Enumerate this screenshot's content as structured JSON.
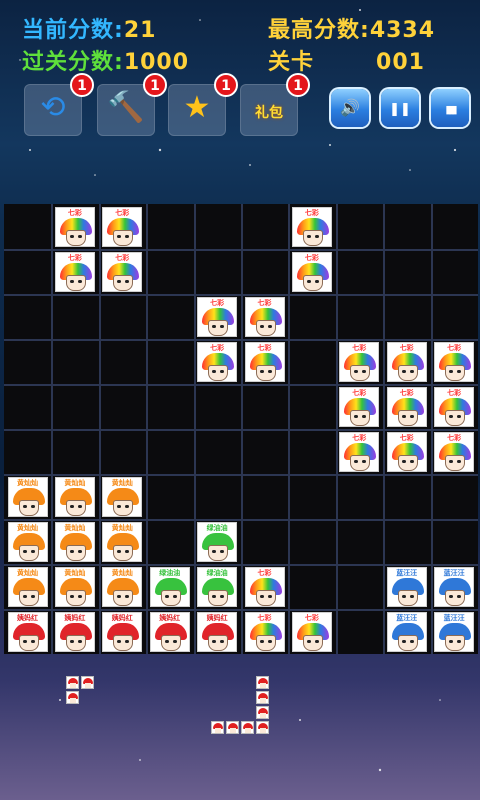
{
  "hud": {
    "current_score_label": "当前分数:",
    "current_score": "21",
    "high_score_label": "最高分数:",
    "high_score": "4334",
    "pass_score_label": "过关分数:",
    "pass_score": "1000",
    "level_label": "关卡",
    "level": "001"
  },
  "tools": [
    {
      "name": "refresh-icon",
      "glyph": "⟲",
      "count": "1"
    },
    {
      "name": "hammer-icon",
      "glyph": "🔨",
      "count": "1"
    },
    {
      "name": "star-wand-icon",
      "glyph": "★",
      "count": "1"
    },
    {
      "name": "gift-pack-icon",
      "glyph": "礼包",
      "count": "1"
    }
  ],
  "controls": [
    {
      "name": "sound-icon",
      "glyph": "🔊"
    },
    {
      "name": "pause-icon",
      "glyph": "❚❚"
    },
    {
      "name": "stats-icon",
      "glyph": "▮▮▮"
    }
  ],
  "colors": {
    "rainbow": "#ff3b3b",
    "orange": "#f58a17",
    "green": "#38c23e",
    "red": "#e0242a",
    "blue": "#2f78d8",
    "hud_text": "#33b7ff",
    "hud_value": "#ffd23a"
  },
  "labels": {
    "rainbow": "七彩",
    "orange": "黄灿灿",
    "green": "绿油油",
    "red": "姨妈红",
    "blue": "蓝汪汪"
  },
  "board": {
    "rows": 10,
    "cols": 10,
    "tiles": [
      {
        "row": 0,
        "col": 1,
        "kind": "rainbow"
      },
      {
        "row": 0,
        "col": 2,
        "kind": "rainbow"
      },
      {
        "row": 0,
        "col": 6,
        "kind": "rainbow"
      },
      {
        "row": 1,
        "col": 1,
        "kind": "rainbow"
      },
      {
        "row": 1,
        "col": 2,
        "kind": "rainbow"
      },
      {
        "row": 1,
        "col": 6,
        "kind": "rainbow"
      },
      {
        "row": 2,
        "col": 4,
        "kind": "rainbow"
      },
      {
        "row": 2,
        "col": 5,
        "kind": "rainbow"
      },
      {
        "row": 3,
        "col": 4,
        "kind": "rainbow"
      },
      {
        "row": 3,
        "col": 5,
        "kind": "rainbow"
      },
      {
        "row": 3,
        "col": 7,
        "kind": "rainbow"
      },
      {
        "row": 3,
        "col": 8,
        "kind": "rainbow"
      },
      {
        "row": 3,
        "col": 9,
        "kind": "rainbow"
      },
      {
        "row": 4,
        "col": 7,
        "kind": "rainbow"
      },
      {
        "row": 4,
        "col": 8,
        "kind": "rainbow"
      },
      {
        "row": 4,
        "col": 9,
        "kind": "rainbow"
      },
      {
        "row": 5,
        "col": 7,
        "kind": "rainbow"
      },
      {
        "row": 5,
        "col": 8,
        "kind": "rainbow"
      },
      {
        "row": 5,
        "col": 9,
        "kind": "rainbow"
      },
      {
        "row": 6,
        "col": 0,
        "kind": "orange"
      },
      {
        "row": 6,
        "col": 1,
        "kind": "orange"
      },
      {
        "row": 6,
        "col": 2,
        "kind": "orange"
      },
      {
        "row": 7,
        "col": 0,
        "kind": "orange"
      },
      {
        "row": 7,
        "col": 1,
        "kind": "orange"
      },
      {
        "row": 7,
        "col": 2,
        "kind": "orange"
      },
      {
        "row": 7,
        "col": 4,
        "kind": "green"
      },
      {
        "row": 8,
        "col": 0,
        "kind": "orange"
      },
      {
        "row": 8,
        "col": 1,
        "kind": "orange"
      },
      {
        "row": 8,
        "col": 2,
        "kind": "orange"
      },
      {
        "row": 8,
        "col": 3,
        "kind": "green"
      },
      {
        "row": 8,
        "col": 4,
        "kind": "green"
      },
      {
        "row": 8,
        "col": 5,
        "kind": "rainbow"
      },
      {
        "row": 8,
        "col": 8,
        "kind": "blue"
      },
      {
        "row": 8,
        "col": 9,
        "kind": "blue"
      },
      {
        "row": 9,
        "col": 0,
        "kind": "red"
      },
      {
        "row": 9,
        "col": 1,
        "kind": "red"
      },
      {
        "row": 9,
        "col": 2,
        "kind": "red"
      },
      {
        "row": 9,
        "col": 3,
        "kind": "red"
      },
      {
        "row": 9,
        "col": 4,
        "kind": "red"
      },
      {
        "row": 9,
        "col": 5,
        "kind": "rainbow"
      },
      {
        "row": 9,
        "col": 6,
        "kind": "rainbow"
      },
      {
        "row": 9,
        "col": 8,
        "kind": "blue"
      },
      {
        "row": 9,
        "col": 9,
        "kind": "blue"
      }
    ]
  },
  "pieces": [
    {
      "cells": [
        [
          0,
          0
        ],
        [
          0,
          1
        ],
        [
          1,
          0
        ]
      ]
    },
    {
      "cells": [
        [
          0,
          3
        ],
        [
          1,
          3
        ],
        [
          2,
          3
        ],
        [
          3,
          0
        ],
        [
          3,
          1
        ],
        [
          3,
          2
        ],
        [
          3,
          3
        ]
      ]
    }
  ]
}
